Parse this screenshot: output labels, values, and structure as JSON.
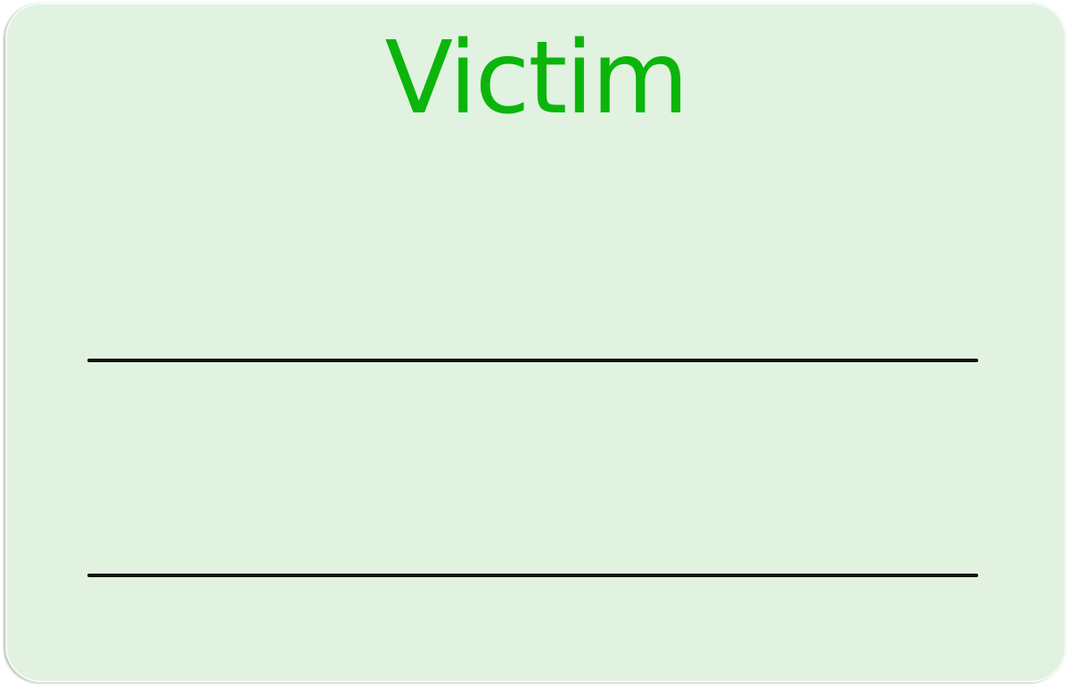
{
  "card": {
    "title": "Victim",
    "title_color": "#0bb50b",
    "background_color": "#e1f2e0"
  }
}
